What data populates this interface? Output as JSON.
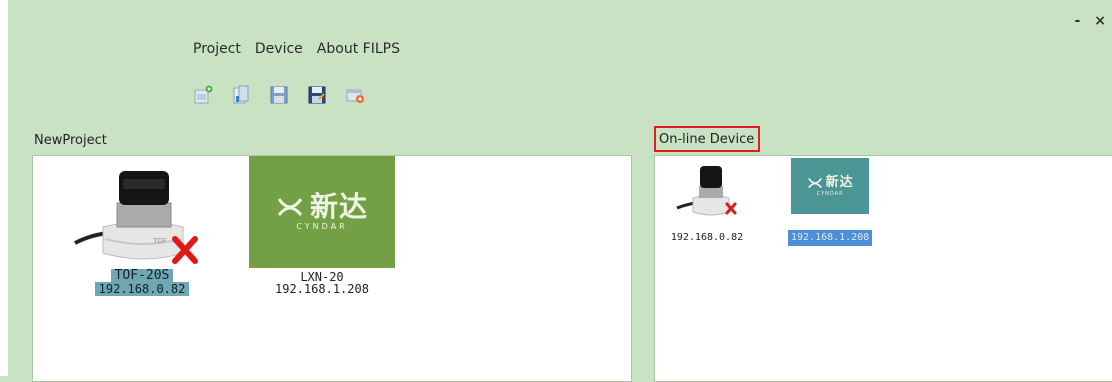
{
  "window": {
    "minimize": "-",
    "close": "×"
  },
  "menu": [
    "Project",
    "Device",
    "About FILPS"
  ],
  "toolbar": [
    "new-project-icon",
    "open-file-icon",
    "save-icon",
    "save-as-icon",
    "add-device-icon"
  ],
  "project_panel": {
    "title": "NewProject",
    "devices": [
      {
        "model": "TOF-20S",
        "ip": "192.168.0.82",
        "status": "offline",
        "selected": true
      },
      {
        "model": "LXN-20",
        "ip": "192.168.1.208",
        "logo_text": "新达",
        "logo_sub": "CYNDAR",
        "selected": false
      }
    ]
  },
  "online_panel": {
    "title": "On-line Device",
    "devices": [
      {
        "ip": "192.168.0.82",
        "status": "offline"
      },
      {
        "ip": "192.168.1.208",
        "logo_text": "新达",
        "logo_sub": "CYNDAR",
        "selected": true
      }
    ]
  },
  "colors": {
    "background": "#c8e2c3",
    "selection": "#6fa7b3",
    "logo_green": "#74a045",
    "logo_teal": "#4c9595",
    "highlight_border": "#e02020"
  }
}
